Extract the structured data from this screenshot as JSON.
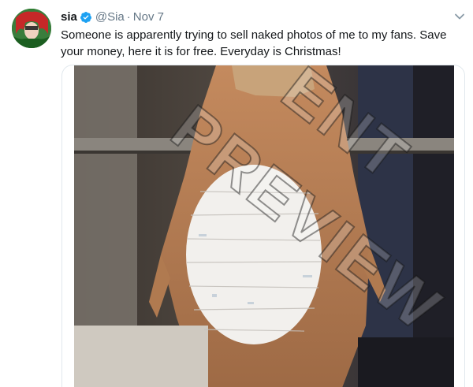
{
  "tweet": {
    "display_name": "sia",
    "handle": "@Sia",
    "separator": "·",
    "date": "Nov 7",
    "text": "Someone is apparently trying to sell naked photos of me to my fans. Save your money, here it is for free. Everyday is Christmas!"
  },
  "media": {
    "watermark": "PREVIEW",
    "watermark_top": "ENT"
  },
  "icons": {
    "verified": "verified-badge-icon",
    "caret": "chevron-down-icon"
  },
  "colors": {
    "text": "#14171a",
    "secondary": "#657786",
    "verified": "#1da1f2",
    "border": "#e1e8ed"
  }
}
